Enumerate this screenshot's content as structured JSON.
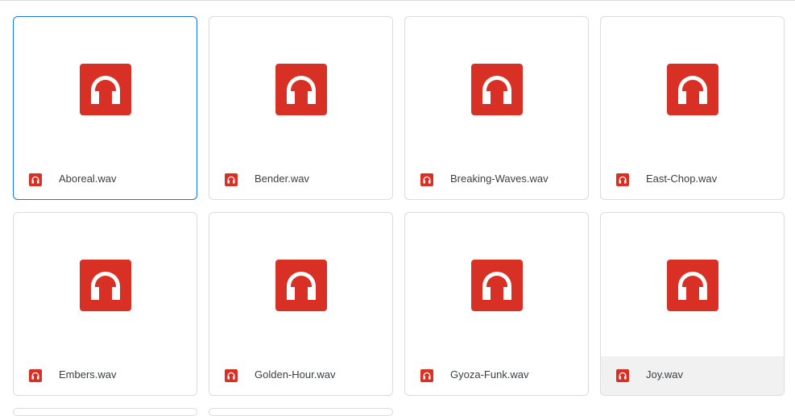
{
  "colors": {
    "audio_red": "#d93025",
    "selected_border": "#1a73e8",
    "card_border": "#dadce0",
    "hover_bg": "#f1f1f1"
  },
  "file_icon": "headphones-icon",
  "files": [
    {
      "name": "Aboreal.wav"
    },
    {
      "name": "Bender.wav"
    },
    {
      "name": "Breaking-Waves.wav"
    },
    {
      "name": "East-Chop.wav"
    },
    {
      "name": "Embers.wav"
    },
    {
      "name": "Golden-Hour.wav"
    },
    {
      "name": "Gyoza-Funk.wav"
    },
    {
      "name": "Joy.wav"
    }
  ]
}
